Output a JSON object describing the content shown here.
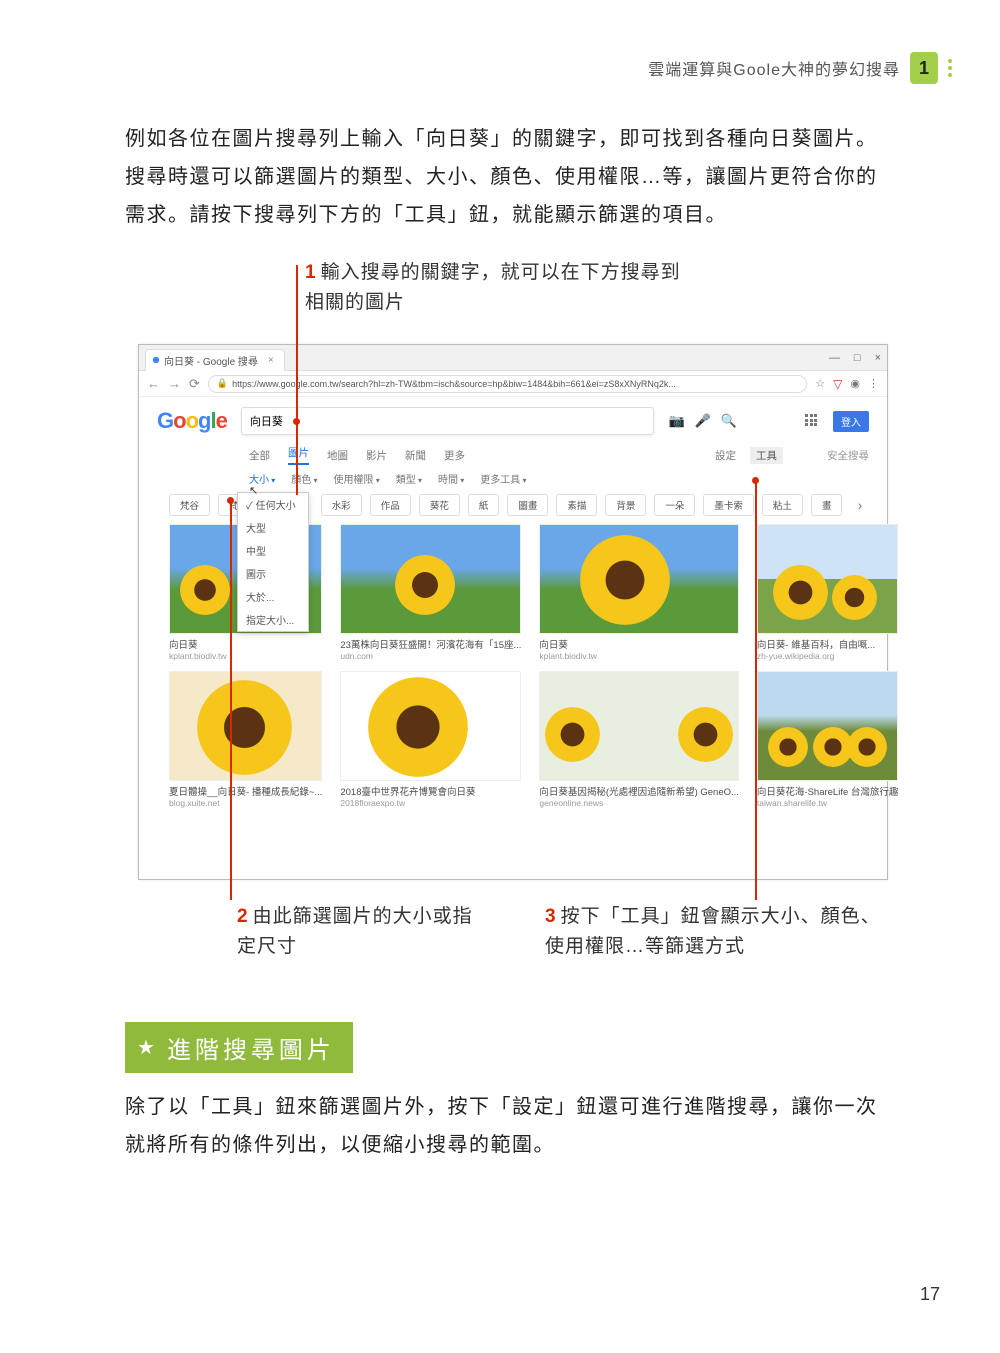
{
  "header": {
    "title": "雲端運算與Goole大神的夢幻搜尋",
    "chapter": "1"
  },
  "paragraphs": {
    "p1": "例如各位在圖片搜尋列上輸入「向日葵」的關鍵字，即可找到各種向日葵圖片。搜尋時還可以篩選圖片的類型、大小、顏色、使用權限…等，讓圖片更符合你的需求。請按下搜尋列下方的「工具」鈕，就能顯示篩選的項目。",
    "p2": "除了以「工具」鈕來篩選圖片外，按下「設定」鈕還可進行進階搜尋，讓你一次就將所有的條件列出，以便縮小搜尋的範圍。"
  },
  "annotations": {
    "a1": {
      "num": "1",
      "text": "輸入搜尋的關鍵字，就可以在下方搜尋到相關的圖片"
    },
    "a2": {
      "num": "2",
      "text": "由此篩選圖片的大小或指定尺寸"
    },
    "a3": {
      "num": "3",
      "text": "按下「工具」鈕會顯示大小、顏色、使用權限…等篩選方式"
    }
  },
  "section": {
    "title": "進階搜尋圖片"
  },
  "browser": {
    "tab_title": "向日葵 - Google 搜尋",
    "win_buttons": {
      "min": "—",
      "max": "□",
      "close": "×"
    },
    "nav": {
      "back": "←",
      "fwd": "→",
      "reload": "⟳"
    },
    "url_lock": "🔒",
    "url": "https://www.google.com.tw/search?hl=zh-TW&tbm=isch&source=hp&biw=1484&bih=661&ei=zS8xXNyRNq2k...",
    "star": "☆",
    "shield": "▽",
    "user": "◉",
    "menu": "⋮",
    "logo": {
      "g1": "G",
      "o1": "o",
      "o2": "o",
      "g2": "g",
      "l": "l",
      "e": "e"
    },
    "search_value": "向日葵",
    "cam_icon": "📷",
    "mic_icon": "🎤",
    "search_icon": "🔍",
    "login": "登入",
    "tabs": [
      "全部",
      "圖片",
      "地圖",
      "影片",
      "新聞",
      "更多"
    ],
    "settings": "設定",
    "tools": "工具",
    "safesearch": "安全搜尋",
    "filters": [
      "大小",
      "顏色",
      "使用權限",
      "類型",
      "時間",
      "更多工具"
    ],
    "size_label": "大小",
    "size_menu": [
      "任何大小",
      "大型",
      "中型",
      "圖示",
      "大於...",
      "指定大小..."
    ],
    "chips": [
      "梵谷",
      "梵高",
      "水彩",
      "作品",
      "葵花",
      "紙",
      "圖畫",
      "素描",
      "背景",
      "一朵",
      "墨卡索",
      "粘土",
      "畫"
    ],
    "chip_next": "›",
    "results_row1": [
      {
        "cap": "向日葵",
        "src": "kplant.biodiv.tw"
      },
      {
        "cap": "23萬株向日葵狂盛開！河濱花海有「15座...",
        "src": "udn.com"
      },
      {
        "cap": "向日葵",
        "src": "kplant.biodiv.tw"
      },
      {
        "cap": "向日葵- 維基百科，自由嘅...",
        "src": "zh-yue.wikipedia.org"
      }
    ],
    "results_row2": [
      {
        "cap": "夏日體操__向日葵- 播種成長紀錄~...",
        "src": "blog.xuite.net"
      },
      {
        "cap": "2018臺中世界花卉博覽會向日葵",
        "src": "2018floraexpo.tw"
      },
      {
        "cap": "向日葵基因揭秘(光處裡因追隨新希望) GeneO...",
        "src": "geneonline.news"
      },
      {
        "cap": "向日葵花海-ShareLife 台灣旅行趣",
        "src": "taiwan.sharelife.tw"
      }
    ]
  },
  "page_number": "17"
}
